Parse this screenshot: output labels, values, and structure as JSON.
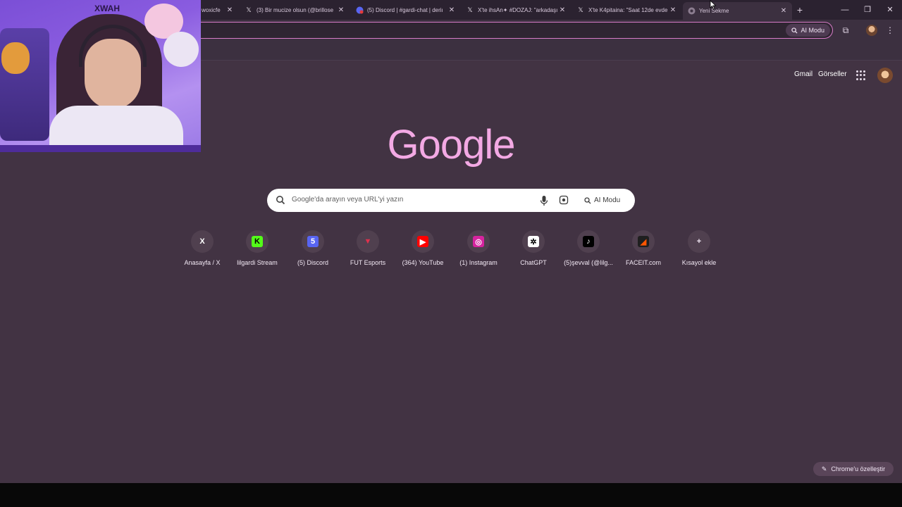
{
  "tabs": [
    {
      "title": "woxicfe",
      "icon": "x-logo-icon",
      "active": false
    },
    {
      "title": "(3) Bir mucize olsun (@brillose",
      "icon": "x-logo-icon",
      "active": false
    },
    {
      "title": "(5) Discord | #gardi-chat | deriı",
      "icon": "discord-icon",
      "active": false
    },
    {
      "title": "X'te ihsAn✦ #DOZAJ: \"arkadaşı",
      "icon": "x-logo-icon",
      "active": false
    },
    {
      "title": "X'te K4pitaina: \"Saat 12de evde",
      "icon": "x-logo-icon",
      "active": false
    },
    {
      "title": "Yeni Sekme",
      "icon": "chrome-icon",
      "active": true
    }
  ],
  "toolbar": {
    "ai_mode_label": "AI Modu"
  },
  "header_links": {
    "gmail": "Gmail",
    "images": "Görseller"
  },
  "logo_text": "Google",
  "search": {
    "placeholder": "Google'da arayın veya URL'yi yazın",
    "ai_mode_label": "AI Modu"
  },
  "shortcuts": [
    {
      "label": "Anasayfa / X",
      "icon": "x-logo-icon",
      "bg": "#50404f",
      "fg": "#ffffff",
      "glyph": "X"
    },
    {
      "label": "lilgardi Stream",
      "icon": "kick-icon",
      "bg": "#53fc18",
      "fg": "#000000",
      "glyph": "K"
    },
    {
      "label": "(5) Discord",
      "icon": "discord-icon",
      "bg": "#5865f2",
      "fg": "#ffffff",
      "glyph": "5"
    },
    {
      "label": "FUT Esports",
      "icon": "fut-esports-icon",
      "bg": "#50404f",
      "fg": "#e0314d",
      "glyph": "▼"
    },
    {
      "label": "(364) YouTube",
      "icon": "youtube-icon",
      "bg": "#ff0000",
      "fg": "#ffffff",
      "glyph": "▶"
    },
    {
      "label": "(1) Instagram",
      "icon": "instagram-icon",
      "bg": "#d6249f",
      "fg": "#ffffff",
      "glyph": "◎"
    },
    {
      "label": "ChatGPT",
      "icon": "chatgpt-icon",
      "bg": "#ffffff",
      "fg": "#000000",
      "glyph": "✲"
    },
    {
      "label": "(5)şevval (@lilg...",
      "icon": "tiktok-icon",
      "bg": "#000000",
      "fg": "#ffffff",
      "glyph": "♪"
    },
    {
      "label": "FACEIT.com",
      "icon": "faceit-icon",
      "bg": "#1f1f1f",
      "fg": "#ff5500",
      "glyph": "◢"
    },
    {
      "label": "Kısayol ekle",
      "icon": "plus-icon",
      "bg": "#50404f",
      "fg": "#f2e8f4",
      "glyph": "+"
    }
  ],
  "customize_label": "Chrome'u özelleştir",
  "webcam": {
    "brand_text": "XWAH"
  },
  "colors": {
    "page_bg": "#423343",
    "accent_pink": "#f3a9e4",
    "omnibox_border": "#d87cc8"
  }
}
